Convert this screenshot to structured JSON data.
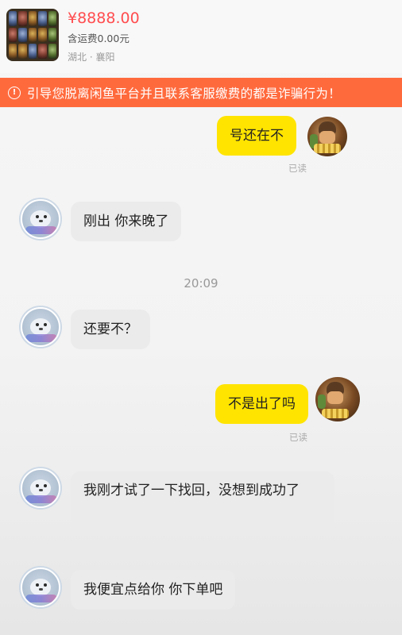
{
  "product": {
    "price": "¥8888.00",
    "shipping": "含运费0.00元",
    "location": "湖北 · 襄阳"
  },
  "warning": {
    "icon": "warning-circle-icon",
    "text": "引导您脱离闲鱼平台并且联系客服缴费的都是诈骗行为！"
  },
  "messages": [
    {
      "from": "me",
      "text": "号还在不",
      "status": "已读"
    },
    {
      "from": "them",
      "text": "刚出 你来晚了"
    },
    {
      "from": "them",
      "text": "还要不？"
    },
    {
      "from": "me",
      "text": "不是出了吗",
      "status": "已读"
    },
    {
      "from": "them",
      "text": "我刚才试了一下找回，没想到成功了"
    },
    {
      "from": "them",
      "text": "我便宜点给你 你下单吧"
    }
  ],
  "timestamp": "20:09",
  "colors": {
    "warning_bg": "#ff6a3d",
    "price": "#ff4d4f",
    "my_bubble": "#ffe400",
    "their_bubble": "#ebebeb"
  }
}
